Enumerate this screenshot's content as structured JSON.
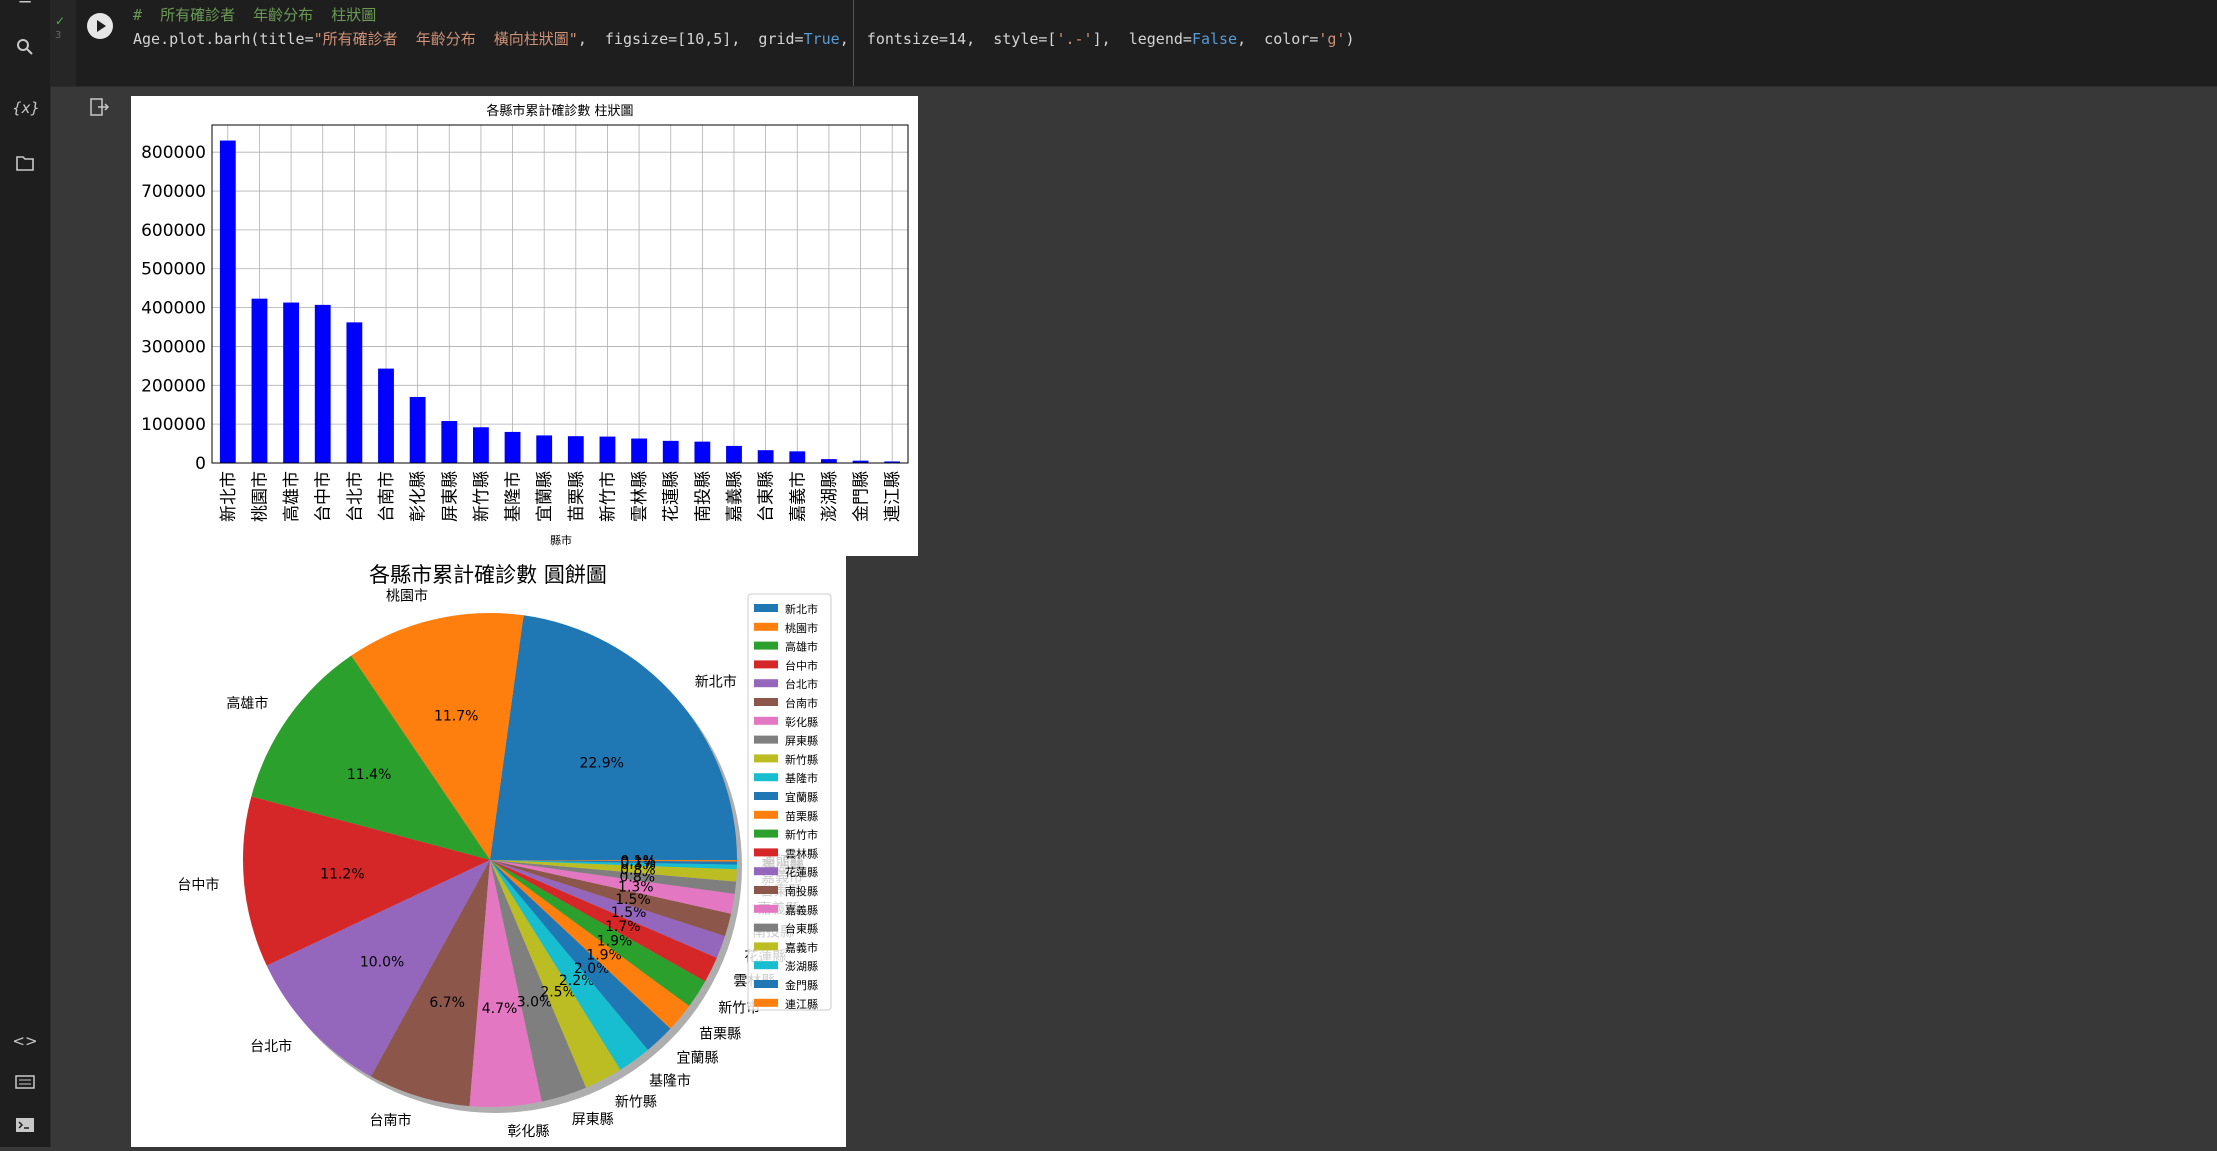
{
  "cell": {
    "comment": "#  所有確診者  年齡分布  柱狀圖",
    "code_prefix": "Age.plot.barh(title=",
    "code_title": "\"所有確診者  年齡分布  橫向柱狀圖\"",
    "code_args1": ",  figsize=",
    "code_fig": "[10,5]",
    "code_args2": ",  grid=",
    "code_true": "True",
    "code_args3": ",  fontsize=",
    "code_fs": "14",
    "code_args4": ",  style=[",
    "code_style": "'.-'",
    "code_args5": "],  legend=",
    "code_false": "False",
    "code_args6": ",  color=",
    "code_color": "'g'",
    "code_end": ")",
    "line_numbers": "3",
    "status": "✓"
  },
  "sidebar": {
    "icons": [
      "menu-icon",
      "search-icon",
      "variables-icon",
      "folder-icon",
      "code-icon",
      "terminal-keyboard-icon",
      "terminal-icon"
    ],
    "variables_label": "{x}"
  },
  "colors": {
    "bar": "#0000ff",
    "pie": [
      "#1f77b4",
      "#ff7f0e",
      "#2ca02c",
      "#d62728",
      "#9467bd",
      "#8c564b",
      "#e377c2",
      "#7f7f7f",
      "#bcbd22",
      "#17becf",
      "#1f77b4",
      "#ff7f0e",
      "#2ca02c",
      "#d62728",
      "#9467bd",
      "#8c564b",
      "#e377c2",
      "#7f7f7f",
      "#bcbd22",
      "#17becf",
      "#1f77b4",
      "#ff7f0e"
    ]
  },
  "chart_data": [
    {
      "type": "bar",
      "title": "各縣市累計確診數 柱狀圖",
      "xlabel": "縣市",
      "ylabel": "",
      "ylim": [
        0,
        870000
      ],
      "yticks": [
        0,
        100000,
        200000,
        300000,
        400000,
        500000,
        600000,
        700000,
        800000
      ],
      "grid": true,
      "categories": [
        "新北市",
        "桃園市",
        "高雄市",
        "台中市",
        "台北市",
        "台南市",
        "彰化縣",
        "屏東縣",
        "新竹縣",
        "基隆市",
        "宜蘭縣",
        "苗栗縣",
        "新竹市",
        "雲林縣",
        "花蓮縣",
        "南投縣",
        "嘉義縣",
        "台東縣",
        "嘉義市",
        "澎湖縣",
        "金門縣",
        "連江縣"
      ],
      "values": [
        830000,
        423000,
        413000,
        407000,
        362000,
        243000,
        170000,
        108000,
        92000,
        80000,
        71000,
        69000,
        68000,
        63000,
        57000,
        55000,
        44000,
        33000,
        30000,
        10000,
        6000,
        4000
      ]
    },
    {
      "type": "pie",
      "title": "各縣市累計確診數 圓餅圖",
      "legend_position": "right",
      "shadow": true,
      "labels": [
        "新北市",
        "桃園市",
        "高雄市",
        "台中市",
        "台北市",
        "台南市",
        "彰化縣",
        "屏東縣",
        "新竹縣",
        "基隆市",
        "宜蘭縣",
        "苗栗縣",
        "新竹市",
        "雲林縣",
        "花蓮縣",
        "南投縣",
        "嘉義縣",
        "台東縣",
        "嘉義市",
        "澎湖縣",
        "金門縣",
        "連江縣"
      ],
      "values": [
        22.9,
        11.7,
        11.4,
        11.2,
        10.0,
        6.7,
        4.7,
        3.0,
        2.5,
        2.2,
        2.0,
        1.9,
        1.9,
        1.7,
        1.5,
        1.5,
        1.3,
        0.8,
        0.8,
        0.3,
        0.2,
        0.1
      ],
      "pct_labels": [
        "22.9%",
        "11.7%",
        "11.4%",
        "11.2%",
        "10.0%",
        "6.7%",
        "4.7%",
        "3.0%",
        "2.5%",
        "2.2%",
        "2.0%",
        "1.9%",
        "1.9%",
        "1.7%",
        "1.5%",
        "1.5%",
        "1.3%",
        "0.8%",
        "0.8%",
        "0.3%",
        "0.2%",
        "0.1%"
      ]
    }
  ]
}
